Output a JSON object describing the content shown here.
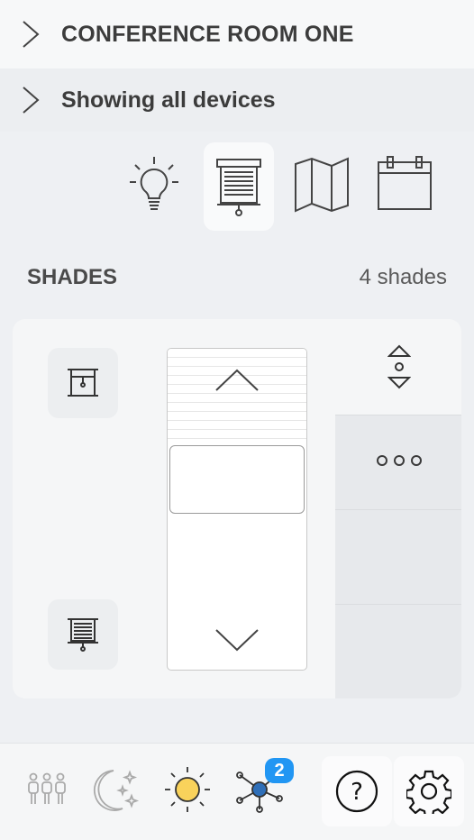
{
  "header": {
    "room_name": "CONFERENCE ROOM ONE",
    "filter_label": "Showing all devices"
  },
  "device_filters": [
    {
      "name": "lights",
      "icon": "light-bulb-icon",
      "active": false
    },
    {
      "name": "shades",
      "icon": "shade-icon",
      "active": true
    },
    {
      "name": "floorplan",
      "icon": "map-icon",
      "active": false
    },
    {
      "name": "schedule",
      "icon": "calendar-icon",
      "active": false
    }
  ],
  "section": {
    "title": "SHADES",
    "count": "4 shades"
  },
  "shade_control": {
    "open_icon": "shade-open-icon",
    "close_icon": "shade-closed-icon",
    "up_icon": "chevron-up-icon",
    "down_icon": "chevron-down-icon",
    "stop_icon": "up-stop-down-icon",
    "more_icon": "more-dots-icon"
  },
  "bottom_bar": {
    "items": [
      {
        "icon": "occupancy-icon"
      },
      {
        "icon": "night-mode-icon"
      },
      {
        "icon": "daylight-icon"
      },
      {
        "icon": "network-icon",
        "badge": "2"
      },
      {
        "icon": "help-icon"
      },
      {
        "icon": "gear-icon"
      }
    ],
    "network_badge": "2"
  },
  "colors": {
    "accent": "#2196f3",
    "sun": "#f9d25b",
    "network_node": "#2f6fb8"
  }
}
